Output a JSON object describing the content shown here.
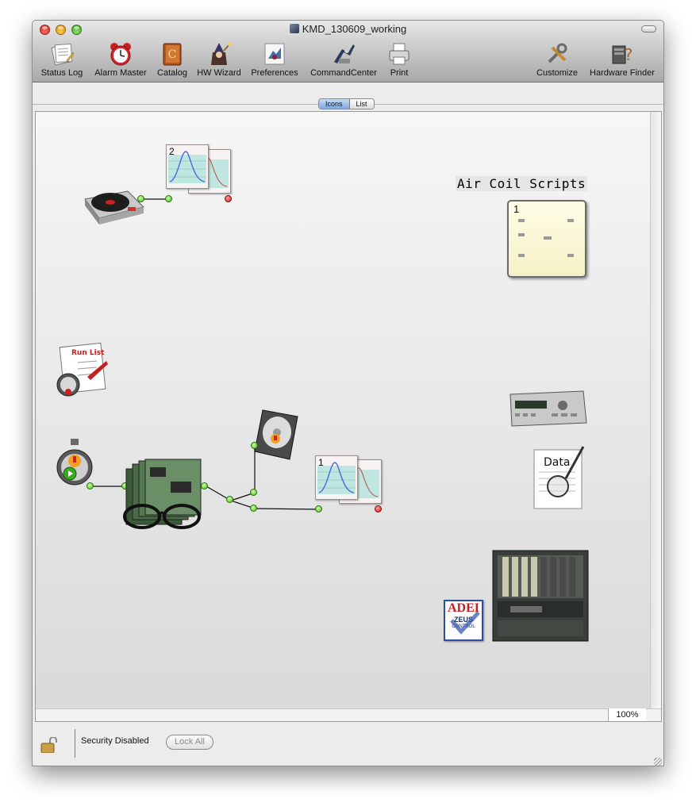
{
  "window": {
    "title": "KMD_130609_working",
    "close_icon": "close-icon",
    "minimize_icon": "minimize-icon",
    "zoom_icon": "zoom-icon"
  },
  "toolbar": {
    "items": [
      {
        "label": "Status Log",
        "icon": "status-log-icon"
      },
      {
        "label": "Alarm Master",
        "icon": "alarm-clock-icon"
      },
      {
        "label": "Catalog",
        "icon": "catalog-book-icon"
      },
      {
        "label": "HW Wizard",
        "icon": "wizard-icon"
      },
      {
        "label": "Preferences",
        "icon": "preferences-icon"
      },
      {
        "label": "CommandCenter",
        "icon": "command-center-icon"
      },
      {
        "label": "Print",
        "icon": "printer-icon"
      },
      {
        "label": "Customize",
        "icon": "tools-icon"
      },
      {
        "label": "Hardware Finder",
        "icon": "hardware-finder-icon"
      }
    ]
  },
  "view_mode": {
    "options": [
      "Icons",
      "List"
    ],
    "selected": "Icons"
  },
  "canvas": {
    "zoom": "100%",
    "script_group": {
      "label": "Air Coil Scripts",
      "count": "1"
    },
    "plot_top": {
      "number": "2"
    },
    "plot_bottom": {
      "number": "1"
    },
    "run_list": {
      "label": "Run List"
    },
    "adei": {
      "label": "ADEI",
      "sub": "ZEUS",
      "sub2": "CONTROL"
    },
    "data_doc": {
      "label": "Data"
    },
    "colors": {
      "connector_green": "#4bbf1c",
      "connector_red": "#d41c1c",
      "script_bg": "#fffde6"
    }
  },
  "status_bar": {
    "security_text": "Security Disabled",
    "lock_all_label": "Lock All",
    "lock_icon": "unlocked-padlock-icon"
  }
}
